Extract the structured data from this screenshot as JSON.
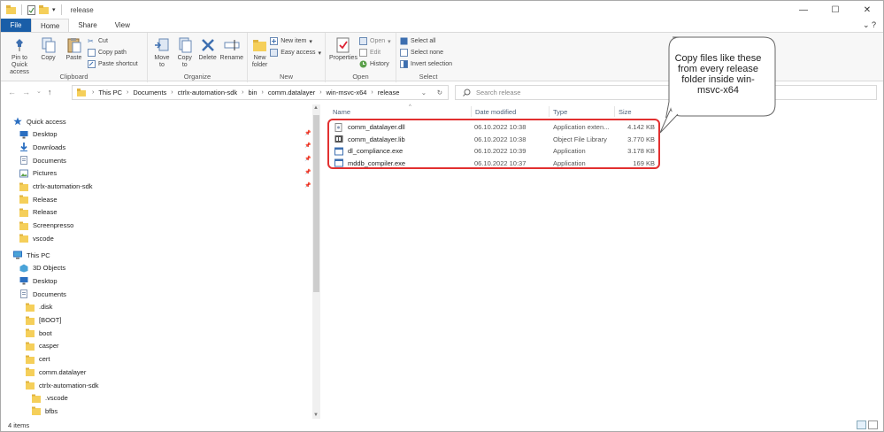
{
  "window": {
    "title": "release",
    "controls": [
      "—",
      "☐",
      "✕"
    ]
  },
  "ribbon_tabs": [
    "File",
    "Home",
    "Share",
    "View"
  ],
  "ribbon": {
    "clipboard": {
      "label": "Clipboard",
      "pin": "Pin to Quick access",
      "copy": "Copy",
      "paste": "Paste",
      "cut": "Cut",
      "copy_path": "Copy path",
      "paste_shortcut": "Paste shortcut"
    },
    "organize": {
      "label": "Organize",
      "move_to": "Move to",
      "copy_to": "Copy to",
      "delete": "Delete",
      "rename": "Rename"
    },
    "new": {
      "label": "New",
      "new_folder": "New folder",
      "new_item": "New item",
      "easy_access": "Easy access"
    },
    "open": {
      "label": "Open",
      "properties": "Properties",
      "open": "Open",
      "edit": "Edit",
      "history": "History"
    },
    "select": {
      "label": "Select",
      "select_all": "Select all",
      "select_none": "Select none",
      "invert": "Invert selection"
    }
  },
  "address": {
    "crumbs": [
      "This PC",
      "Documents",
      "ctrlx-automation-sdk",
      "bin",
      "comm.datalayer",
      "win-msvc-x64",
      "release"
    ]
  },
  "search": {
    "placeholder": "Search release"
  },
  "nav_tree": [
    {
      "label": "Quick access",
      "icon": "star-icon",
      "indent": 0,
      "pinned": false
    },
    {
      "label": "Desktop",
      "icon": "desktop-icon",
      "indent": 1,
      "pinned": true
    },
    {
      "label": "Downloads",
      "icon": "download-icon",
      "indent": 1,
      "pinned": true
    },
    {
      "label": "Documents",
      "icon": "documents-icon",
      "indent": 1,
      "pinned": true
    },
    {
      "label": "Pictures",
      "icon": "pictures-icon",
      "indent": 1,
      "pinned": true
    },
    {
      "label": "ctrlx-automation-sdk",
      "icon": "folder-icon",
      "indent": 1,
      "pinned": true
    },
    {
      "label": "Release",
      "icon": "folder-icon",
      "indent": 1,
      "pinned": false
    },
    {
      "label": "Release",
      "icon": "folder-icon",
      "indent": 1,
      "pinned": false
    },
    {
      "label": "Screenpresso",
      "icon": "folder-icon",
      "indent": 1,
      "pinned": false
    },
    {
      "label": "vscode",
      "icon": "folder-icon",
      "indent": 1,
      "pinned": false
    },
    {
      "label": "This PC",
      "icon": "pc-icon",
      "indent": 0,
      "pinned": false
    },
    {
      "label": "3D Objects",
      "icon": "objects3d-icon",
      "indent": 1,
      "pinned": false
    },
    {
      "label": "Desktop",
      "icon": "desktop-icon",
      "indent": 1,
      "pinned": false
    },
    {
      "label": "Documents",
      "icon": "documents-icon",
      "indent": 1,
      "pinned": false
    },
    {
      "label": ".disk",
      "icon": "folder-icon",
      "indent": 2,
      "pinned": false
    },
    {
      "label": "[BOOT]",
      "icon": "folder-icon",
      "indent": 2,
      "pinned": false
    },
    {
      "label": "boot",
      "icon": "folder-icon",
      "indent": 2,
      "pinned": false
    },
    {
      "label": "casper",
      "icon": "folder-icon",
      "indent": 2,
      "pinned": false
    },
    {
      "label": "cert",
      "icon": "folder-icon",
      "indent": 2,
      "pinned": false
    },
    {
      "label": "comm.datalayer",
      "icon": "folder-icon",
      "indent": 2,
      "pinned": false
    },
    {
      "label": "ctrlx-automation-sdk",
      "icon": "folder-icon",
      "indent": 2,
      "pinned": false
    },
    {
      "label": ".vscode",
      "icon": "folder-icon",
      "indent": 3,
      "pinned": false
    },
    {
      "label": "bfbs",
      "icon": "folder-icon",
      "indent": 3,
      "pinned": false
    }
  ],
  "columns": [
    "Name",
    "Date modified",
    "Type",
    "Size"
  ],
  "files": [
    {
      "name": "comm_datalayer.dll",
      "date": "06.10.2022 10:38",
      "type": "Application exten...",
      "size": "4.142 KB",
      "icon": "dll-file-icon"
    },
    {
      "name": "comm_datalayer.lib",
      "date": "06.10.2022 10:38",
      "type": "Object File Library",
      "size": "3.770 KB",
      "icon": "lib-file-icon"
    },
    {
      "name": "dl_compliance.exe",
      "date": "06.10.2022 10:39",
      "type": "Application",
      "size": "3.178 KB",
      "icon": "exe-file-icon"
    },
    {
      "name": "mddb_compiler.exe",
      "date": "06.10.2022 10:37",
      "type": "Application",
      "size": "169 KB",
      "icon": "exe-file-icon"
    }
  ],
  "callout": {
    "text": "Copy files like these from every release folder inside win-msvc-x64"
  },
  "status": {
    "items": "4 items"
  },
  "colors": {
    "file_tab": "#1a5ea8",
    "highlight": "#e23030",
    "folder": "#f5cf5a"
  }
}
